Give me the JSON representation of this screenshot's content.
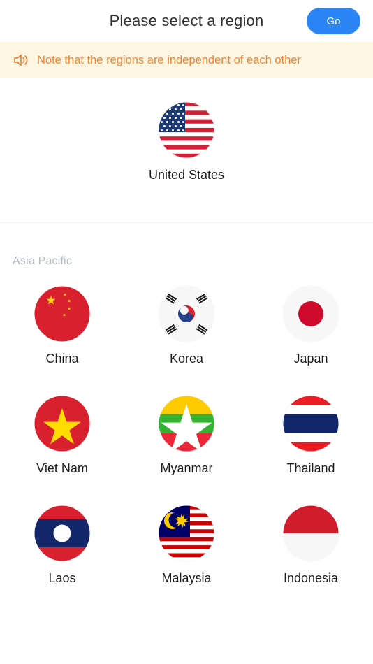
{
  "header": {
    "title": "Please select a region",
    "go_label": "Go",
    "accent_color": "#2b85f5"
  },
  "notice": {
    "text": "Note that the regions are independent of each other",
    "icon": "speaker-icon",
    "text_color": "#f08437",
    "background_color": "#fdf6e3"
  },
  "sections": [
    {
      "title": "",
      "name": "global-region-section",
      "rows": [
        [
          {
            "label": "United States",
            "flag": "us"
          }
        ]
      ]
    },
    {
      "title": "Asia Pacific",
      "name": "asia-pacific-section",
      "rows": [
        [
          {
            "label": "China",
            "flag": "cn"
          },
          {
            "label": "Korea",
            "flag": "kr"
          },
          {
            "label": "Japan",
            "flag": "jp"
          }
        ],
        [
          {
            "label": "Viet Nam",
            "flag": "vn"
          },
          {
            "label": "Myanmar",
            "flag": "mm"
          },
          {
            "label": "Thailand",
            "flag": "th"
          }
        ],
        [
          {
            "label": "Laos",
            "flag": "la"
          },
          {
            "label": "Malaysia",
            "flag": "my"
          },
          {
            "label": "Indonesia",
            "flag": "id"
          }
        ]
      ]
    }
  ]
}
